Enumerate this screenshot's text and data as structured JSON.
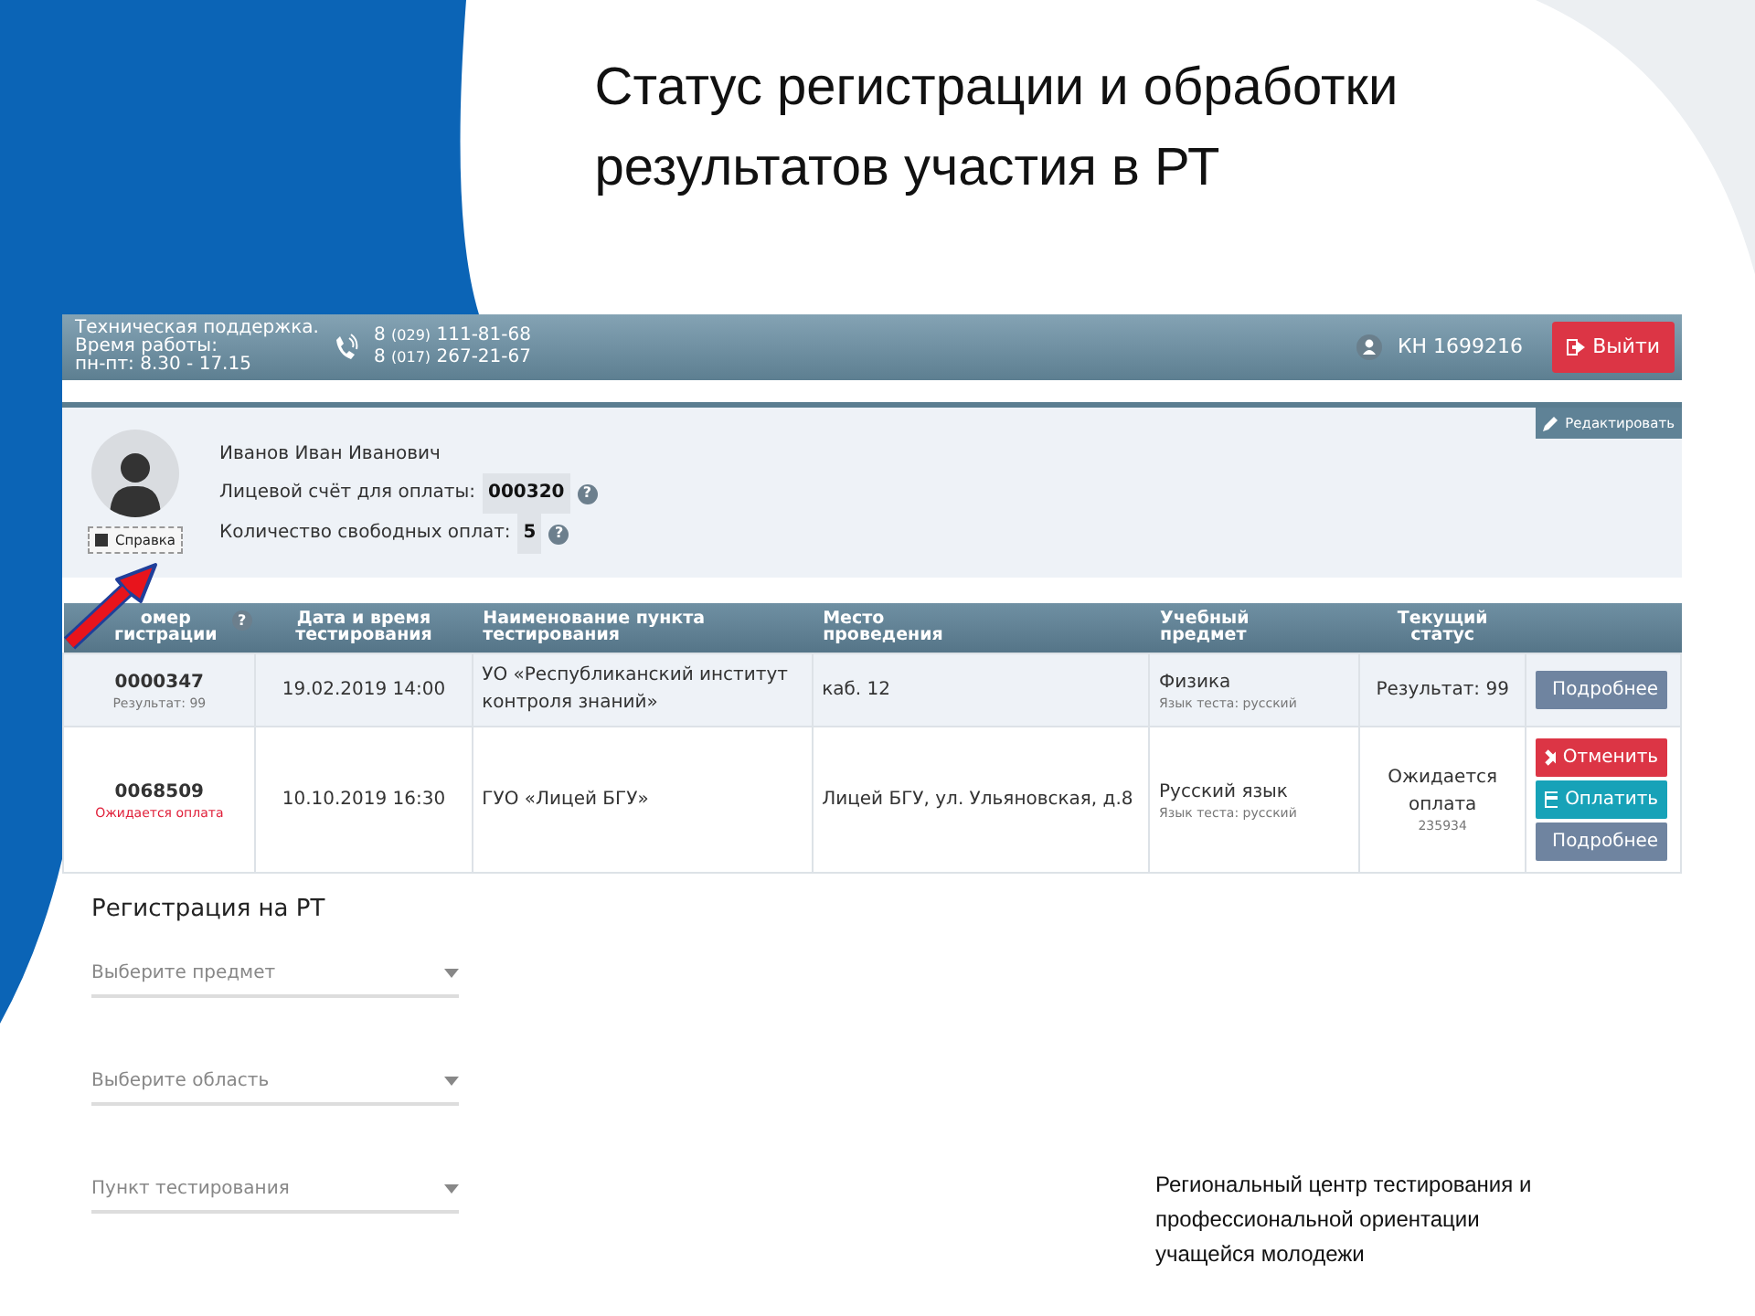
{
  "slide_title": [
    "Статус регистрации и обработки",
    "результатов участия в РТ"
  ],
  "topbar": {
    "support_lines": [
      "Техническая поддержка.",
      "Время работы:",
      "пн-пт: 8.30 - 17.15"
    ],
    "phones": [
      {
        "prefix": "8",
        "area": "(029)",
        "number": "111-81-68"
      },
      {
        "prefix": "8",
        "area": "(017)",
        "number": "267-21-67"
      }
    ],
    "user_id": "КН 1699216",
    "logout": "Выйти"
  },
  "profile": {
    "edit_button": "Редактировать",
    "name": "Иванов Иван Иванович",
    "fields": [
      {
        "label": "Лицевой счёт для оплаты:",
        "value": "000320",
        "help": "?"
      },
      {
        "label": "Количество свободных оплат:",
        "value": "5",
        "help": "?"
      }
    ],
    "help_button": "Справка"
  },
  "table": {
    "columns": [
      {
        "lines": [
          "омер",
          "гистрации"
        ],
        "help": "?"
      },
      {
        "lines": [
          "Дата и время",
          "тестирования"
        ]
      },
      {
        "lines": [
          "Наименование пункта",
          "тестирования"
        ]
      },
      {
        "lines": [
          "Место",
          "проведения"
        ]
      },
      {
        "lines": [
          "Учебный",
          "предмет"
        ]
      },
      {
        "lines": [
          "Текущий",
          "статус"
        ]
      }
    ],
    "rows": [
      {
        "number": "0000347",
        "note": "Результат: 99",
        "color": "#777777",
        "date": "19.02.2019 14:00",
        "point": "УО «Республиканский институт контроля знаний»",
        "place": "каб. 12",
        "subject": "Физика",
        "language": "Язык теста: русский",
        "status": "Результат: 99",
        "actions": [
          {
            "kind": "details",
            "label": "Подробнее"
          }
        ]
      },
      {
        "number": "0068509",
        "note": "Ожидается оплата",
        "color": "#e0203a",
        "date": "10.10.2019 16:30",
        "point": "ГУО «Лицей БГУ»",
        "place": "Лицей БГУ, ул. Ульяновская, д.8",
        "subject": "Русский язык",
        "language": "Язык теста: русский",
        "status": "Ожидается оплата",
        "status_code": "235934",
        "actions": [
          {
            "kind": "cancel",
            "label": "Отменить"
          },
          {
            "kind": "pay",
            "label": "Оплатить"
          },
          {
            "kind": "details",
            "label": "Подробнее"
          }
        ]
      }
    ]
  },
  "registration": {
    "title": "Регистрация на РТ",
    "selects": [
      {
        "placeholder": "Выберите предмет"
      },
      {
        "placeholder": "Выберите область"
      },
      {
        "placeholder": "Пункт тестирования"
      }
    ]
  },
  "footer_lines": [
    "Региональный центр тестирования и",
    "профессиональной ориентации",
    "учащейся молодежи"
  ]
}
